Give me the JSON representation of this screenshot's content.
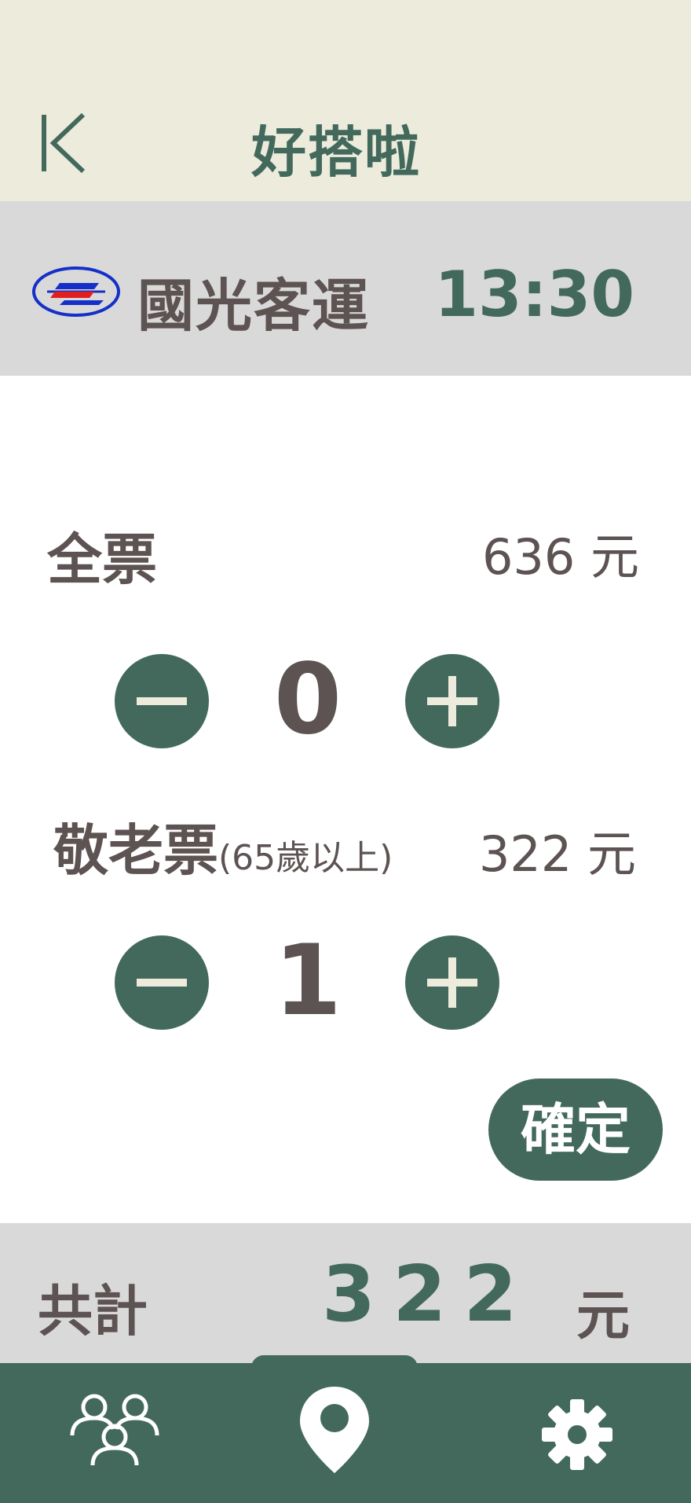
{
  "header": {
    "title": "好搭啦"
  },
  "operator": {
    "name": "國光客運",
    "departure_time": "13:30"
  },
  "tickets": [
    {
      "label": "全票",
      "note": "",
      "price": "636 元",
      "quantity": "0"
    },
    {
      "label": "敬老票",
      "note": "(65歲以上)",
      "price": "322 元",
      "quantity": "1"
    }
  ],
  "confirm_label": "確定",
  "total": {
    "label": "共計",
    "amount": "322",
    "unit": "元"
  },
  "nav": {
    "items": [
      {
        "icon": "group-icon"
      },
      {
        "icon": "location-pin-icon",
        "active": true
      },
      {
        "icon": "gear-icon"
      }
    ]
  },
  "colors": {
    "accent": "#43695d",
    "header_bg": "#ecebdc",
    "panel_bg": "#d9d9d9",
    "text": "#5c5352",
    "icon_light": "#ecebdc"
  }
}
